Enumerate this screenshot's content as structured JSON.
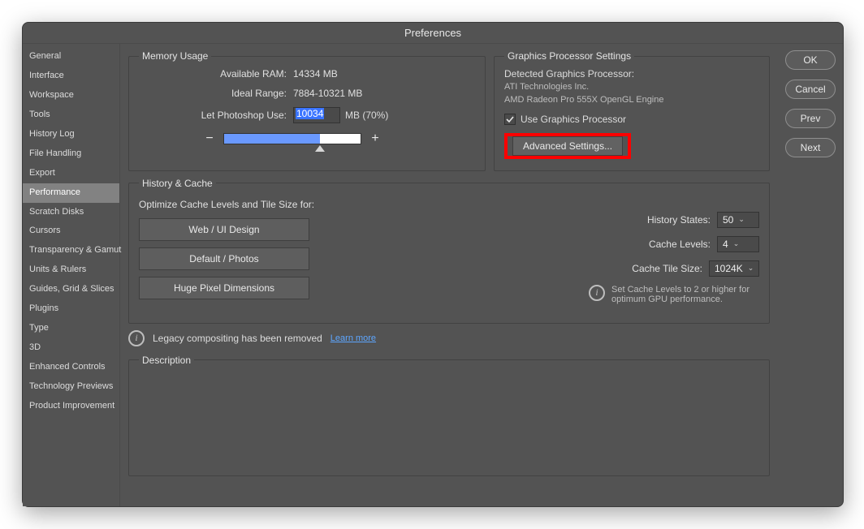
{
  "window": {
    "title": "Preferences"
  },
  "sidebar": {
    "items": [
      "General",
      "Interface",
      "Workspace",
      "Tools",
      "History Log",
      "File Handling",
      "Export",
      "Performance",
      "Scratch Disks",
      "Cursors",
      "Transparency & Gamut",
      "Units & Rulers",
      "Guides, Grid & Slices",
      "Plugins",
      "Type",
      "3D",
      "Enhanced Controls",
      "Technology Previews",
      "Product Improvement"
    ],
    "selected_index": 7
  },
  "actions": {
    "ok": "OK",
    "cancel": "Cancel",
    "prev": "Prev",
    "next": "Next"
  },
  "memory": {
    "legend": "Memory Usage",
    "available_label": "Available RAM:",
    "available_value": "14334 MB",
    "ideal_label": "Ideal Range:",
    "ideal_value": "7884-10321 MB",
    "let_use_label": "Let Photoshop Use:",
    "let_use_value": "10034",
    "let_use_suffix": "MB (70%)",
    "slider_minus": "−",
    "slider_plus": "+"
  },
  "gpu": {
    "legend": "Graphics Processor Settings",
    "detected_label": "Detected Graphics Processor:",
    "vendor": "ATI Technologies Inc.",
    "device": "AMD Radeon Pro 555X OpenGL Engine",
    "use_gpu_label": "Use Graphics Processor",
    "use_gpu_checked": true,
    "advanced_label": "Advanced Settings..."
  },
  "history_cache": {
    "legend": "History & Cache",
    "optimize_label": "Optimize Cache Levels and Tile Size for:",
    "presets": [
      "Web / UI Design",
      "Default / Photos",
      "Huge Pixel Dimensions"
    ],
    "history_states_label": "History States:",
    "history_states_value": "50",
    "cache_levels_label": "Cache Levels:",
    "cache_levels_value": "4",
    "cache_tile_label": "Cache Tile Size:",
    "cache_tile_value": "1024K",
    "hint": "Set Cache Levels to 2 or higher for optimum GPU performance."
  },
  "legacy": {
    "text": "Legacy compositing has been removed",
    "link": "Learn more"
  },
  "description": {
    "legend": "Description"
  }
}
